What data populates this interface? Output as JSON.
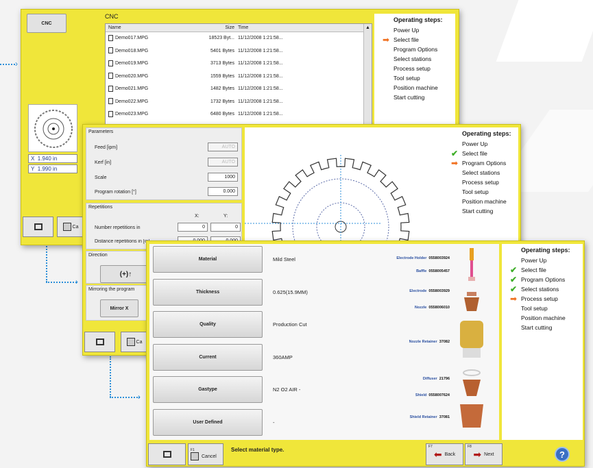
{
  "colors": {
    "accent": "#f0e63a",
    "check": "#3fae29",
    "arrow": "#f07020",
    "link_label": "#2a4fa0"
  },
  "win1": {
    "cnc_button": "CNC",
    "file_panel_title": "CNC",
    "columns": [
      "Name",
      "Size",
      "Time"
    ],
    "files": [
      {
        "name": "Demo017.MPG",
        "size": "18523 Byt...",
        "time": "11/12/2008 1:21:58..."
      },
      {
        "name": "Demo018.MPG",
        "size": "5401 Bytes",
        "time": "11/12/2008 1:21:58..."
      },
      {
        "name": "Demo019.MPG",
        "size": "3713 Bytes",
        "time": "11/12/2008 1:21:58..."
      },
      {
        "name": "Demo020.MPG",
        "size": "1559 Bytes",
        "time": "11/12/2008 1:21:58..."
      },
      {
        "name": "Demo021.MPG",
        "size": "1482 Bytes",
        "time": "11/12/2008 1:21:58..."
      },
      {
        "name": "Demo022.MPG",
        "size": "1732 Bytes",
        "time": "11/12/2008 1:21:58..."
      },
      {
        "name": "Demo023.MPG",
        "size": "6480 Bytes",
        "time": "11/12/2008 1:21:58..."
      }
    ],
    "x_label": "X",
    "x_value": "1.940 in",
    "y_label": "Y",
    "y_value": "1.990 in",
    "cancel_label": "Ca",
    "steps_title": "Operating steps:",
    "steps": [
      "Power Up",
      "Select file",
      "Program Options",
      "Select stations",
      "Process setup",
      "Tool setup",
      "Position machine",
      "Start cutting"
    ]
  },
  "win2": {
    "parameters_title": "Parameters",
    "feed_label": "Feed [ipm]",
    "feed_value": "AUTO",
    "kerf_label": "Kerf [in]",
    "kerf_value": "AUTO",
    "scale_label": "Scale",
    "scale_value": "1000",
    "rotation_label": "Program rotation [°]",
    "rotation_value": "0.000",
    "repetitions_title": "Repetitions",
    "x_col": "X:",
    "y_col": "Y:",
    "num_rep_label": "Number repetitions in",
    "num_rep_x": "0",
    "num_rep_y": "0",
    "dist_rep_label": "Distance repetitions in [in]",
    "dist_rep_x": "0.000",
    "dist_rep_y": "0.000",
    "direction_label": "Direction",
    "direction_button": "(+)↑",
    "mirroring_label": "Mirroring the program",
    "mirror_button": "Mirror X",
    "cancel_label": "Ca",
    "steps_title": "Operating steps:",
    "steps": [
      "Power Up",
      "Select file",
      "Program Options",
      "Select stations",
      "Process setup",
      "Tool setup",
      "Position machine",
      "Start cutting"
    ]
  },
  "win3": {
    "rows": [
      {
        "button": "Material",
        "value": "Mild Steel"
      },
      {
        "button": "Thickness",
        "value": "0.625(15.9MM)"
      },
      {
        "button": "Quality",
        "value": "Production Cut"
      },
      {
        "button": "Current",
        "value": "360AMP"
      },
      {
        "button": "Gastype",
        "value": "N2 O2 AIR -"
      },
      {
        "button": "User Defined",
        "value": "-"
      }
    ],
    "parts": [
      {
        "name": "Electrode Holder",
        "number": "0558003924"
      },
      {
        "name": "Baffle",
        "number": "0558005457"
      },
      {
        "name": "Electrode",
        "number": "0558003929"
      },
      {
        "name": "Nozzle",
        "number": "0558006010"
      },
      {
        "name": "Nozzle Retainer",
        "number": "37082"
      },
      {
        "name": "Diffuser",
        "number": "21796"
      },
      {
        "name": "Shield",
        "number": "0558007624"
      },
      {
        "name": "Shield Retainer",
        "number": "37081"
      }
    ],
    "f1_label": "F1",
    "cancel_label": "Cancel",
    "status_text": "Select material type.",
    "f7_label": "F7",
    "back_label": "Back",
    "f8_label": "F8",
    "next_label": "Next",
    "help_label": "?",
    "steps_title": "Operating steps:",
    "steps": [
      "Power Up",
      "Select file",
      "Program Options",
      "Select stations",
      "Process setup",
      "Tool setup",
      "Position machine",
      "Start cutting"
    ]
  }
}
